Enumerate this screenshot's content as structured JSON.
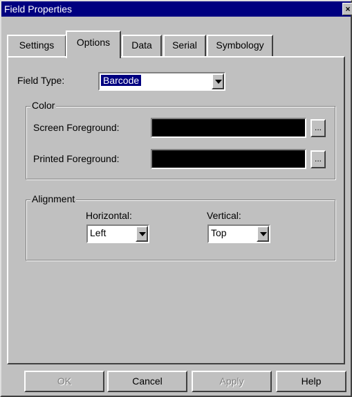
{
  "window": {
    "title": "Field Properties",
    "close_glyph": "×"
  },
  "tabs": [
    {
      "label": "Settings"
    },
    {
      "label": "Options",
      "active": true
    },
    {
      "label": "Data"
    },
    {
      "label": "Serial"
    },
    {
      "label": "Symbology"
    }
  ],
  "field_type": {
    "label": "Field Type:",
    "value": "Barcode"
  },
  "color_group": {
    "legend": "Color",
    "screen_foreground": {
      "label": "Screen Foreground:",
      "color": "#000000",
      "button": "..."
    },
    "printed_foreground": {
      "label": "Printed Foreground:",
      "color": "#000000",
      "button": "..."
    }
  },
  "alignment_group": {
    "legend": "Alignment",
    "horizontal": {
      "label": "Horizontal:",
      "value": "Left"
    },
    "vertical": {
      "label": "Vertical:",
      "value": "Top"
    }
  },
  "buttons": {
    "ok": {
      "label": "OK",
      "enabled": false
    },
    "cancel": {
      "label": "Cancel",
      "enabled": true
    },
    "apply": {
      "label": "Apply",
      "enabled": false
    },
    "help": {
      "label": "Help",
      "enabled": true
    }
  }
}
